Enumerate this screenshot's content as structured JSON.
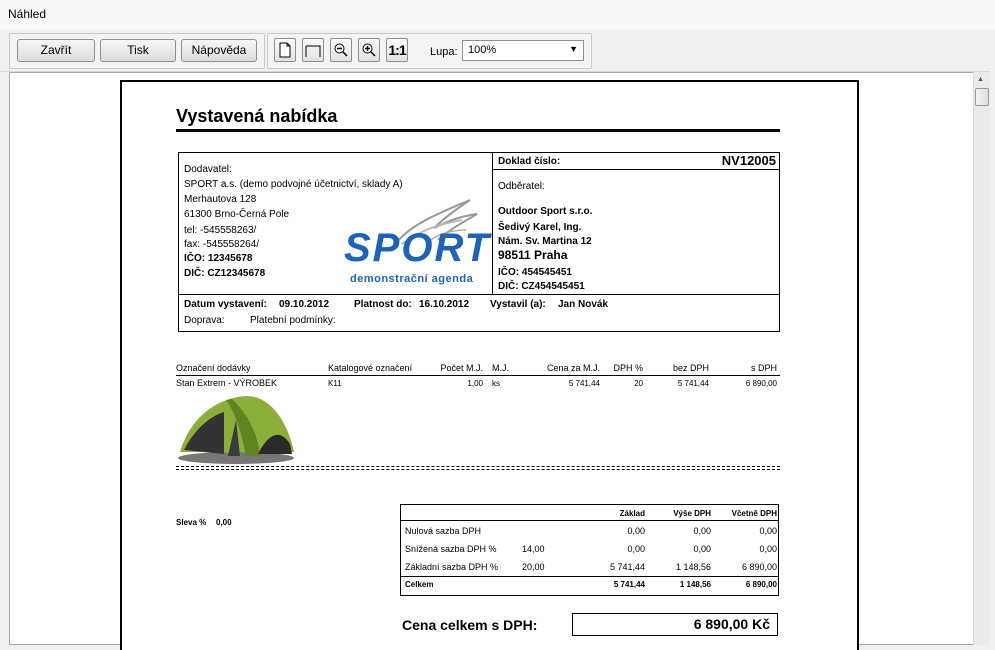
{
  "window": {
    "title": "Náhled"
  },
  "toolbar": {
    "close": "Zavřít",
    "print": "Tisk",
    "help": "Nápověda",
    "one_to_one": "1:1",
    "zoom_label": "Lupa:",
    "zoom_value": "100%"
  },
  "doc": {
    "heading": "Vystavená nabídka",
    "supplier": {
      "label": "Dodavatel:",
      "name": "SPORT a.s. (demo podvojné účetnictví, sklady A)",
      "street": "Merhautova 128",
      "city": "61300 Brno-Černá Pole",
      "tel": "tel:  -545558263/",
      "fax": "fax:  -545558264/",
      "ico": "IČO: 12345678",
      "dic": "DIČ: CZ12345678"
    },
    "logo": {
      "main": "SPORT",
      "sub": "demonstrační agenda"
    },
    "doc_number_label": "Doklad číslo:",
    "doc_number": "NV12005",
    "customer": {
      "label": "Odběratel:",
      "name": "Outdoor Sport s.r.o.",
      "contact": "Šedivý Karel, Ing.",
      "street": "Nám. Sv. Martina 12",
      "city": "98511 Praha",
      "ico": "IČO: 454545451",
      "dic": "DIČ: CZ454545451"
    },
    "issue_date_label": "Datum vystavení:",
    "issue_date": "09.10.2012",
    "valid_label": "Platnost do:",
    "valid_date": "16.10.2012",
    "issued_by_label": "Vystavil (a):",
    "issued_by": "Jan Novák",
    "transport_label": "Doprava:",
    "payment_label": "Platební podmínky:",
    "items_header": {
      "name": "Označení dodávky",
      "catalog": "Katalogové označení",
      "qty": "Počet M.J.",
      "unit": "M.J.",
      "price": "Cena za M.J.",
      "vat": "DPH %",
      "net": "bez DPH",
      "gross": "s DPH"
    },
    "item": {
      "name": "Stan Extrem - VÝROBEK",
      "catalog": "K11",
      "qty": "1,00",
      "unit": "ks",
      "price": "5 741,44",
      "vat": "20",
      "net": "5 741,44",
      "gross": "6 890,00"
    },
    "discount_label": "Sleva %",
    "discount": "0,00",
    "vat_table": {
      "headers": [
        "Základ",
        "Výše DPH",
        "Včetně DPH"
      ],
      "rows": [
        {
          "label": "Nulová sazba DPH",
          "rate": "",
          "base": "0,00",
          "vat": "0,00",
          "total": "0,00"
        },
        {
          "label": "Snížená sazba DPH %",
          "rate": "14,00",
          "base": "0,00",
          "vat": "0,00",
          "total": "0,00"
        },
        {
          "label": "Základní sazba DPH %",
          "rate": "20,00",
          "base": "5 741,44",
          "vat": "1 148,56",
          "total": "6 890,00"
        },
        {
          "label": "Celkem",
          "rate": "",
          "base": "5 741,44",
          "vat": "1 148,56",
          "total": "6 890,00"
        }
      ]
    },
    "total_label": "Cena celkem s DPH:",
    "total_value": "6 890,00  Kč"
  }
}
